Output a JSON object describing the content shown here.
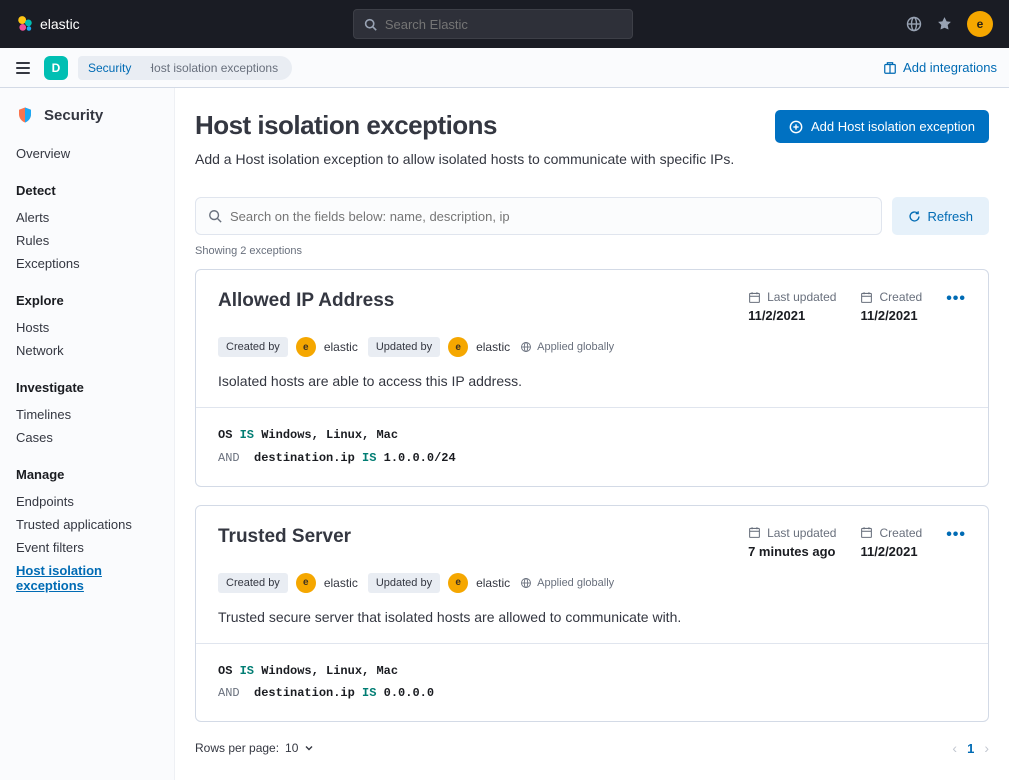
{
  "brand": "elastic",
  "top_search_placeholder": "Search Elastic",
  "avatar_letter": "e",
  "space_letter": "D",
  "breadcrumbs": [
    "Security",
    "Host isolation exceptions"
  ],
  "add_integrations": "Add integrations",
  "sidebar": {
    "title": "Security",
    "groups": [
      {
        "label": null,
        "items": [
          "Overview"
        ]
      },
      {
        "label": "Detect",
        "items": [
          "Alerts",
          "Rules",
          "Exceptions"
        ]
      },
      {
        "label": "Explore",
        "items": [
          "Hosts",
          "Network"
        ]
      },
      {
        "label": "Investigate",
        "items": [
          "Timelines",
          "Cases"
        ]
      },
      {
        "label": "Manage",
        "items": [
          "Endpoints",
          "Trusted applications",
          "Event filters",
          "Host isolation exceptions"
        ]
      }
    ],
    "active": "Host isolation exceptions"
  },
  "page": {
    "title": "Host isolation exceptions",
    "subtitle": "Add a Host isolation exception to allow isolated hosts to communicate with specific IPs.",
    "add_button": "Add Host isolation exception",
    "search_placeholder": "Search on the fields below: name, description, ip",
    "refresh": "Refresh",
    "count_text": "Showing 2 exceptions",
    "rows_per_page_label": "Rows per page:",
    "rows_per_page_value": "10",
    "current_page": "1"
  },
  "labels": {
    "last_updated": "Last updated",
    "created": "Created",
    "created_by": "Created by",
    "updated_by": "Updated by",
    "applied_globally": "Applied globally"
  },
  "exceptions": [
    {
      "title": "Allowed IP Address",
      "last_updated": "11/2/2021",
      "created": "11/2/2021",
      "created_by": "elastic",
      "updated_by": "elastic",
      "description": "Isolated hosts are able to access this IP address.",
      "conditions": [
        {
          "and": false,
          "field": "OS",
          "op": "IS",
          "value": "Windows, Linux, Mac"
        },
        {
          "and": true,
          "field": "destination.ip",
          "op": "IS",
          "value": "1.0.0.0/24"
        }
      ]
    },
    {
      "title": "Trusted Server",
      "last_updated": "7 minutes ago",
      "created": "11/2/2021",
      "created_by": "elastic",
      "updated_by": "elastic",
      "description": "Trusted secure server that isolated hosts are allowed to communicate with.",
      "conditions": [
        {
          "and": false,
          "field": "OS",
          "op": "IS",
          "value": "Windows, Linux, Mac"
        },
        {
          "and": true,
          "field": "destination.ip",
          "op": "IS",
          "value": "0.0.0.0"
        }
      ]
    }
  ]
}
